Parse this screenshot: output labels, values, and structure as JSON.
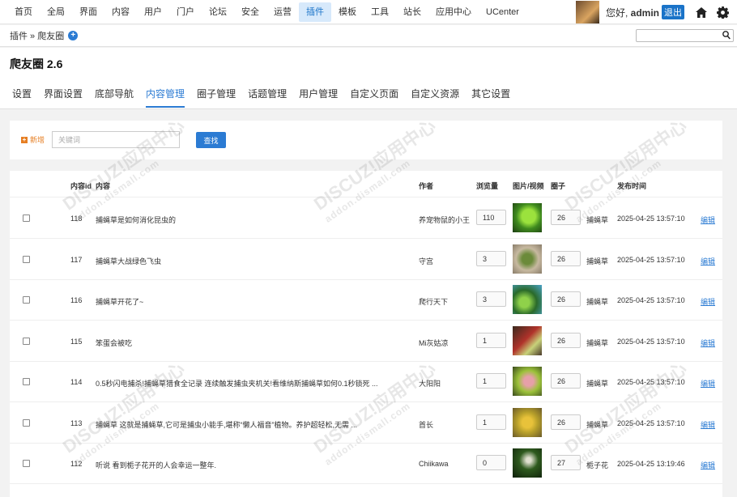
{
  "nav": {
    "items": [
      "首页",
      "全局",
      "界面",
      "内容",
      "用户",
      "门户",
      "论坛",
      "安全",
      "运营",
      "插件",
      "模板",
      "工具",
      "站长",
      "应用中心",
      "UCenter"
    ],
    "active_index": 9
  },
  "user": {
    "greeting": "您好,",
    "name": "admin",
    "logout": "退出"
  },
  "breadcrumb": "插件 » 爬友圈",
  "page_title": "爬友圈 2.6",
  "tabs": [
    "设置",
    "界面设置",
    "底部导航",
    "内容管理",
    "圈子管理",
    "话题管理",
    "用户管理",
    "自定义页面",
    "自定义资源",
    "其它设置"
  ],
  "active_tab": 3,
  "search": {
    "add_label": "新增",
    "placeholder": "关键词",
    "button": "查找"
  },
  "table": {
    "headers": {
      "id": "内容id",
      "content": "内容",
      "author": "作者",
      "views": "浏览量",
      "media": "图片/视频",
      "circle": "圈子",
      "time": "发布时间"
    },
    "edit_label": "编辑",
    "rows": [
      {
        "id": "118",
        "text": "捕蝇草是如何消化昆虫的",
        "author": "养宠物鼠的小王",
        "views": "110",
        "circle_id": "26",
        "circle": "捕蝇草",
        "time": "2025-04-25 13:57:10"
      },
      {
        "id": "117",
        "text": "捕蝇草大战绿色飞虫",
        "author": "守宫",
        "views": "3",
        "circle_id": "26",
        "circle": "捕蝇草",
        "time": "2025-04-25 13:57:10"
      },
      {
        "id": "116",
        "text": "捕蝇草开花了~",
        "author": "爬行天下",
        "views": "3",
        "circle_id": "26",
        "circle": "捕蝇草",
        "time": "2025-04-25 13:57:10"
      },
      {
        "id": "115",
        "text": "笨蛋会被吃",
        "author": "Mi灰姑凉",
        "views": "1",
        "circle_id": "26",
        "circle": "捕蝇草",
        "time": "2025-04-25 13:57:10"
      },
      {
        "id": "114",
        "text": "0.5秒闪电捕杀!捕蝇草猎食全记录 连续触发捕虫夹机关!看维纳斯捕蝇草如何0.1秒锁死 ...",
        "author": "大阳阳",
        "views": "1",
        "circle_id": "26",
        "circle": "捕蝇草",
        "time": "2025-04-25 13:57:10"
      },
      {
        "id": "113",
        "text": "捕蝇草 这就是捕蝇草,它可是捕虫小能手,堪称“懒人福音”植物。养护超轻松,无需 ...",
        "author": "首长",
        "views": "1",
        "circle_id": "26",
        "circle": "捕蝇草",
        "time": "2025-04-25 13:57:10"
      },
      {
        "id": "112",
        "text": "听说 看到栀子花开的人会幸运一整年.",
        "author": "Chiikawa",
        "views": "0",
        "circle_id": "27",
        "circle": "栀子花",
        "time": "2025-04-25 13:19:46"
      }
    ]
  },
  "colors": {
    "accent": "#2b7bd3",
    "add": "#e67e22"
  }
}
